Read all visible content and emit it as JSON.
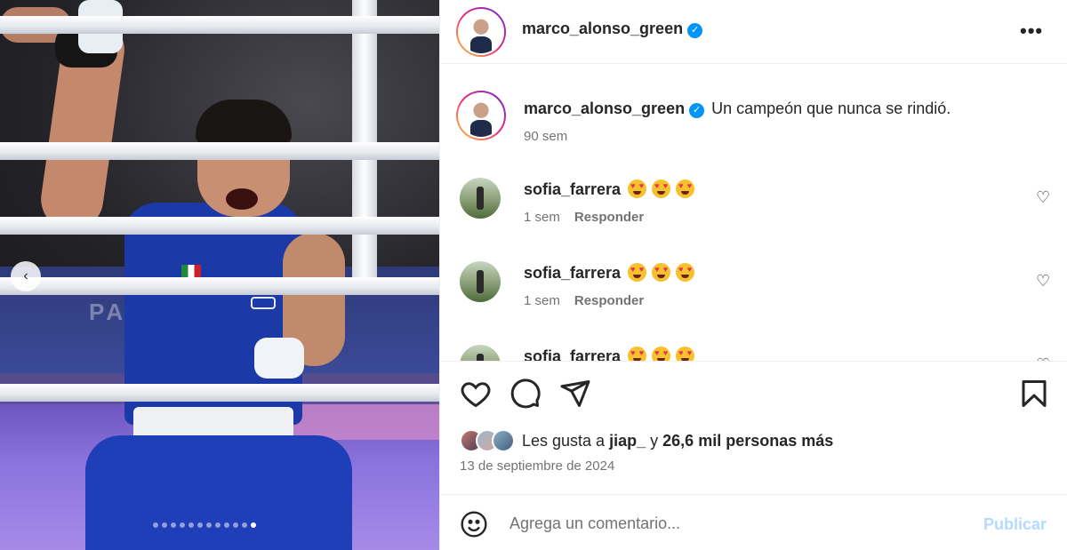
{
  "post": {
    "author": "marco_alonso_green",
    "verified_icon": "verified-badge-icon",
    "more_icon": "more-options-icon",
    "more_glyph": "•••"
  },
  "media": {
    "banner_text": "PAR",
    "prev_glyph": "‹",
    "slide_count": 12,
    "active_slide": 12
  },
  "caption": {
    "author": "marco_alonso_green",
    "text": "Un campeón que nunca se rindió.",
    "time": "90 sem"
  },
  "comments": [
    {
      "author": "sofia_farrera",
      "emoji_count": 3,
      "time": "1 sem",
      "reply_label": "Responder"
    },
    {
      "author": "sofia_farrera",
      "emoji_count": 3,
      "time": "1 sem",
      "reply_label": "Responder"
    },
    {
      "author": "sofia_farrera",
      "emoji_count": 3,
      "time": "",
      "reply_label": ""
    }
  ],
  "actions": {
    "icons": [
      "heart-icon",
      "comment-icon",
      "share-icon",
      "save-icon"
    ]
  },
  "likes": {
    "prefix": "Les gusta a",
    "user": "jiap_",
    "joiner": "y",
    "others": "26,6 mil personas más"
  },
  "date": "13 de septiembre de 2024",
  "add_comment": {
    "placeholder": "Agrega un comentario...",
    "publish_label": "Publicar"
  },
  "colors": {
    "verified": "#0095f6",
    "publish_disabled": "#b3dbff",
    "muted_text": "#737373"
  }
}
